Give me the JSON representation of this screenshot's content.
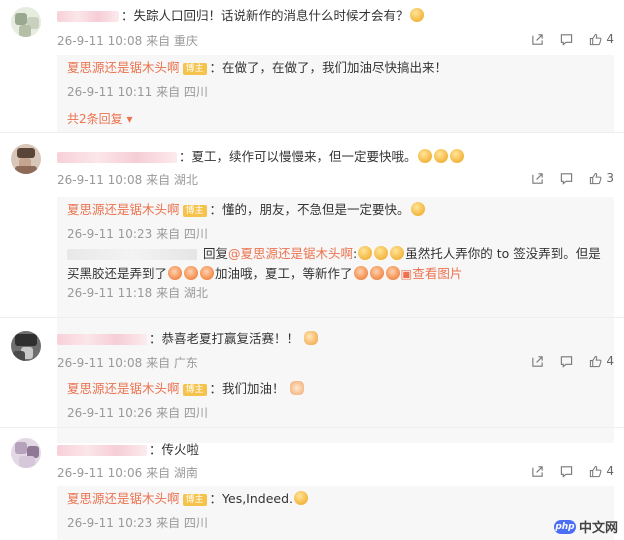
{
  "colors": {
    "author": "#eb7350",
    "meta": "#999999",
    "badge": "#f5c24b"
  },
  "comments": [
    {
      "text": "：失踪人口回归！话说新作的消息什么时候才会有？",
      "emojis": [
        "smile"
      ],
      "time": "26-9-11 10:08",
      "source": "来自 重庆",
      "likes": "4",
      "replies": [
        {
          "author": "夏思源还是锯木头啊",
          "badge": "博主",
          "text": "：在做了，在做了，我们加油尽快搞出来！",
          "time": "26-9-11 10:11",
          "source": "来自 四川"
        }
      ],
      "more": "共2条回复"
    },
    {
      "text": "：夏工，续作可以慢慢来，但一定要快哦。",
      "emojis": [
        "smile",
        "smile",
        "smile"
      ],
      "time": "26-9-11 10:08",
      "source": "来自 湖北",
      "likes": "3",
      "replies": [
        {
          "author": "夏思源还是锯木头啊",
          "badge": "博主",
          "text": "：懂的，朋友，不急但是一定要快。",
          "time": "26-9-11 10:23",
          "source": "来自 四川"
        },
        {
          "reply_word": "回复",
          "at": "@夏思源还是锯木头啊",
          "text_a": "虽然托人弄你的 to 签没弄到。但是买黑胶还是弄到了",
          "text_b": "加油哦，夏工，等新作了",
          "pic": "查看图片",
          "time": "26-9-11 11:18",
          "source": "来自 湖北"
        }
      ]
    },
    {
      "text": "：恭喜老夏打赢复活赛！！",
      "emojis": [
        "clap"
      ],
      "time": "26-9-11 10:08",
      "source": "来自 广东",
      "likes": "4",
      "replies": [
        {
          "author": "夏思源还是锯木头啊",
          "badge": "博主",
          "text": "：我们加油！",
          "time": "26-9-11 10:26",
          "source": "来自 四川"
        }
      ]
    },
    {
      "text": "：传火啦",
      "emojis": [],
      "time": "26-9-11 10:06",
      "source": "来自 湖南",
      "likes": "4",
      "replies": [
        {
          "author": "夏思源还是锯木头啊",
          "badge": "博主",
          "text": "：Yes,Indeed.",
          "time": "26-9-11 10:23",
          "source": "来自 四川"
        }
      ]
    }
  ],
  "watermark": {
    "logo": "php",
    "text": "中文网"
  },
  "icons": {
    "share": "share-icon",
    "comment": "comment-icon",
    "like": "thumbs-up-icon"
  }
}
